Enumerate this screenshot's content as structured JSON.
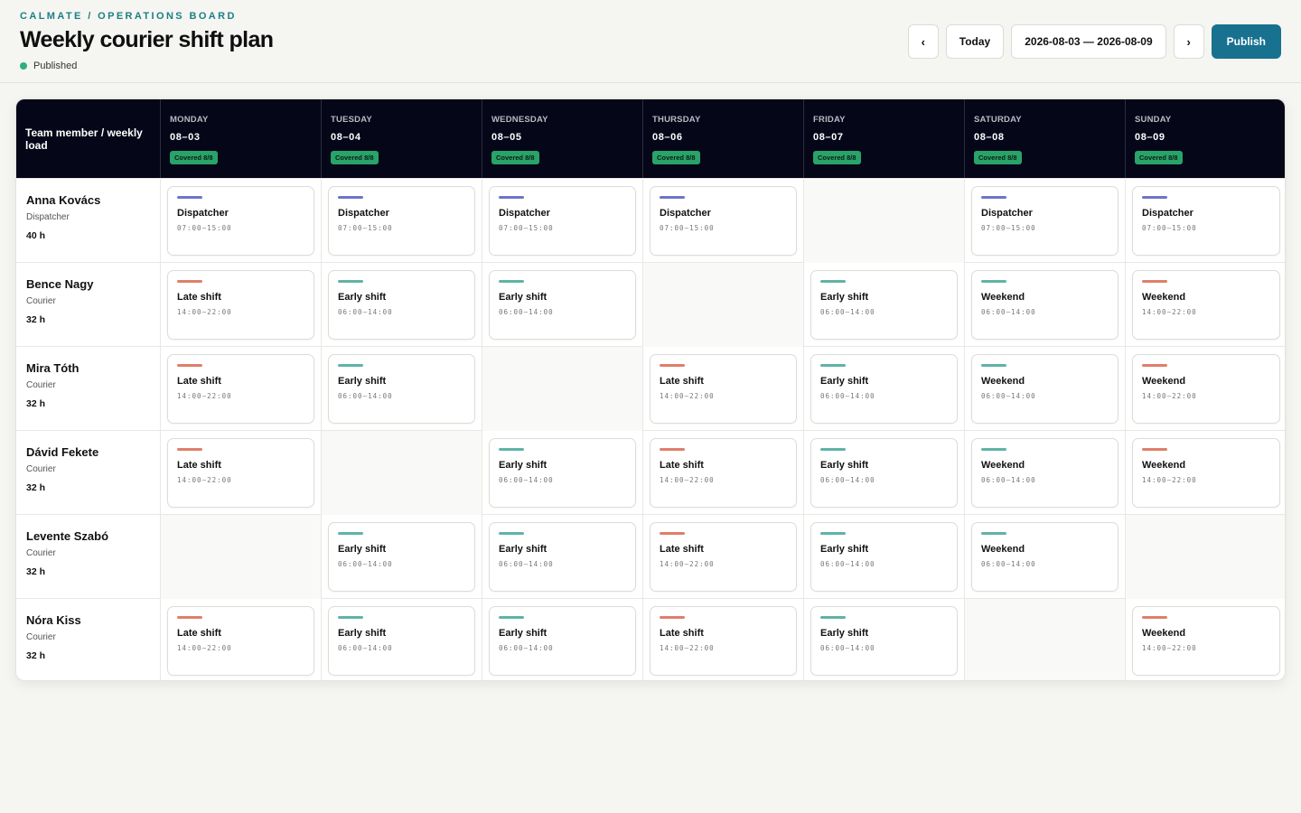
{
  "header": {
    "brand": "CALMATE / OPERATIONS BOARD",
    "title": "Weekly courier shift plan",
    "status": "Published",
    "status_color": "#2fae7e"
  },
  "controls": {
    "prev_label": "‹",
    "today_label": "Today",
    "range_label": "2026-08-03 — 2026-08-09",
    "next_label": "›",
    "publish_label": "Publish"
  },
  "colors": {
    "accent": "#17718f",
    "dispatcher": "#6f73c9",
    "early": "#5fb3a7",
    "late": "#e07e6b",
    "covered_badge": "#29a36a"
  },
  "table": {
    "first_header": "Team member / weekly load",
    "days": [
      {
        "name": "MONDAY",
        "date": "08–03",
        "badge": "Covered 8/8"
      },
      {
        "name": "TUESDAY",
        "date": "08–04",
        "badge": "Covered 8/8"
      },
      {
        "name": "WEDNESDAY",
        "date": "08–05",
        "badge": "Covered 8/8"
      },
      {
        "name": "THURSDAY",
        "date": "08–06",
        "badge": "Covered 8/8"
      },
      {
        "name": "FRIDAY",
        "date": "08–07",
        "badge": "Covered 8/8"
      },
      {
        "name": "SATURDAY",
        "date": "08–08",
        "badge": "Covered 8/8"
      },
      {
        "name": "SUNDAY",
        "date": "08–09",
        "badge": "Covered 8/8"
      }
    ],
    "members": [
      {
        "name": "Anna Kovács",
        "role": "Dispatcher",
        "load": "40 h",
        "shifts": [
          {
            "label": "Dispatcher",
            "time": "07:00–15:00",
            "kind": "dispatcher"
          },
          {
            "label": "Dispatcher",
            "time": "07:00–15:00",
            "kind": "dispatcher"
          },
          {
            "label": "Dispatcher",
            "time": "07:00–15:00",
            "kind": "dispatcher"
          },
          {
            "label": "Dispatcher",
            "time": "07:00–15:00",
            "kind": "dispatcher"
          },
          null,
          {
            "label": "Dispatcher",
            "time": "07:00–15:00",
            "kind": "dispatcher"
          },
          {
            "label": "Dispatcher",
            "time": "07:00–15:00",
            "kind": "dispatcher"
          }
        ]
      },
      {
        "name": "Bence Nagy",
        "role": "Courier",
        "load": "32 h",
        "shifts": [
          {
            "label": "Late shift",
            "time": "14:00–22:00",
            "kind": "late"
          },
          {
            "label": "Early shift",
            "time": "06:00–14:00",
            "kind": "early"
          },
          {
            "label": "Early shift",
            "time": "06:00–14:00",
            "kind": "early"
          },
          null,
          {
            "label": "Early shift",
            "time": "06:00–14:00",
            "kind": "early"
          },
          {
            "label": "Weekend",
            "time": "06:00–14:00",
            "kind": "early"
          },
          {
            "label": "Weekend",
            "time": "14:00–22:00",
            "kind": "late"
          }
        ]
      },
      {
        "name": "Mira Tóth",
        "role": "Courier",
        "load": "32 h",
        "shifts": [
          {
            "label": "Late shift",
            "time": "14:00–22:00",
            "kind": "late"
          },
          {
            "label": "Early shift",
            "time": "06:00–14:00",
            "kind": "early"
          },
          null,
          {
            "label": "Late shift",
            "time": "14:00–22:00",
            "kind": "late"
          },
          {
            "label": "Early shift",
            "time": "06:00–14:00",
            "kind": "early"
          },
          {
            "label": "Weekend",
            "time": "06:00–14:00",
            "kind": "early"
          },
          {
            "label": "Weekend",
            "time": "14:00–22:00",
            "kind": "late"
          }
        ]
      },
      {
        "name": "Dávid Fekete",
        "role": "Courier",
        "load": "32 h",
        "shifts": [
          {
            "label": "Late shift",
            "time": "14:00–22:00",
            "kind": "late"
          },
          null,
          {
            "label": "Early shift",
            "time": "06:00–14:00",
            "kind": "early"
          },
          {
            "label": "Late shift",
            "time": "14:00–22:00",
            "kind": "late"
          },
          {
            "label": "Early shift",
            "time": "06:00–14:00",
            "kind": "early"
          },
          {
            "label": "Weekend",
            "time": "06:00–14:00",
            "kind": "early"
          },
          {
            "label": "Weekend",
            "time": "14:00–22:00",
            "kind": "late"
          }
        ]
      },
      {
        "name": "Levente Szabó",
        "role": "Courier",
        "load": "32 h",
        "shifts": [
          null,
          {
            "label": "Early shift",
            "time": "06:00–14:00",
            "kind": "early"
          },
          {
            "label": "Early shift",
            "time": "06:00–14:00",
            "kind": "early"
          },
          {
            "label": "Late shift",
            "time": "14:00–22:00",
            "kind": "late"
          },
          {
            "label": "Early shift",
            "time": "06:00–14:00",
            "kind": "early"
          },
          {
            "label": "Weekend",
            "time": "06:00–14:00",
            "kind": "early"
          },
          null
        ]
      },
      {
        "name": "Nóra Kiss",
        "role": "Courier",
        "load": "32 h",
        "shifts": [
          {
            "label": "Late shift",
            "time": "14:00–22:00",
            "kind": "late"
          },
          {
            "label": "Early shift",
            "time": "06:00–14:00",
            "kind": "early"
          },
          {
            "label": "Early shift",
            "time": "06:00–14:00",
            "kind": "early"
          },
          {
            "label": "Late shift",
            "time": "14:00–22:00",
            "kind": "late"
          },
          {
            "label": "Early shift",
            "time": "06:00–14:00",
            "kind": "early"
          },
          null,
          {
            "label": "Weekend",
            "time": "14:00–22:00",
            "kind": "late"
          }
        ]
      }
    ]
  }
}
